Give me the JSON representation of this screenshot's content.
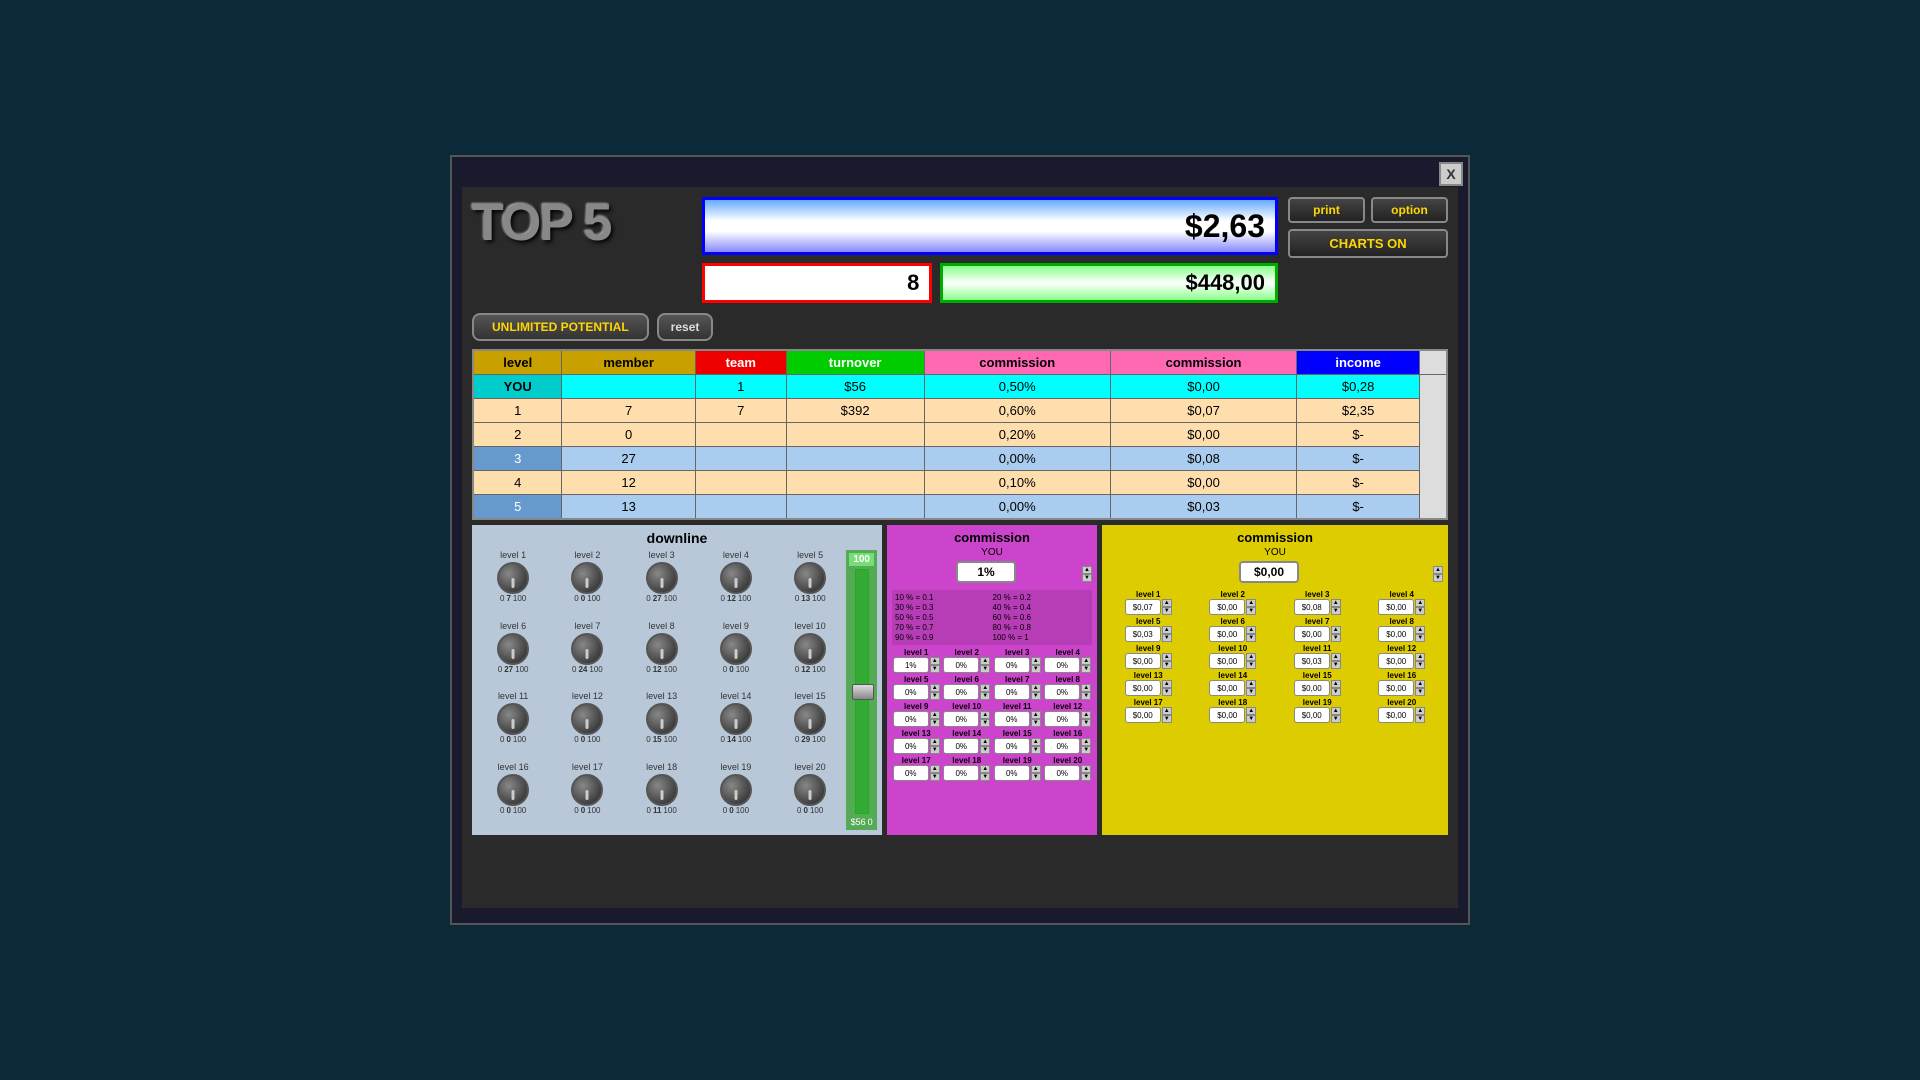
{
  "window": {
    "close_label": "X"
  },
  "header": {
    "logo": "TOP 5",
    "main_value": "$2,63",
    "red_value": "8",
    "green_value": "$448,00",
    "print_label": "print",
    "option_label": "option",
    "charts_label": "CHARTS ON",
    "unlimited_label": "UNLIMITED POTENTIAL",
    "reset_label": "reset"
  },
  "table": {
    "headers": [
      "level",
      "member",
      "team",
      "turnover",
      "commission",
      "commission",
      "income"
    ],
    "rows": [
      {
        "level": "YOU",
        "member": "",
        "team": "1",
        "turnover": "$56",
        "comm1": "0,50%",
        "comm2": "$0,00",
        "income": "$0,28"
      },
      {
        "level": "1",
        "member": "7",
        "team": "7",
        "turnover": "$392",
        "comm1": "0,60%",
        "comm2": "$0,07",
        "income": "$2,35"
      },
      {
        "level": "2",
        "member": "0",
        "team": "",
        "turnover": "",
        "comm1": "0,20%",
        "comm2": "$0,00",
        "income": "$-"
      },
      {
        "level": "3",
        "member": "27",
        "team": "",
        "turnover": "",
        "comm1": "0,00%",
        "comm2": "$0,08",
        "income": "$-"
      },
      {
        "level": "4",
        "member": "12",
        "team": "",
        "turnover": "",
        "comm1": "0,10%",
        "comm2": "$0,00",
        "income": "$-"
      },
      {
        "level": "5",
        "member": "13",
        "team": "",
        "turnover": "",
        "comm1": "0,00%",
        "comm2": "$0,03",
        "income": "$-"
      }
    ]
  },
  "downline": {
    "title": "downline",
    "slider_top": "100",
    "slider_bottom_left": "$56",
    "slider_bottom_right": "0",
    "levels": [
      {
        "label": "level 1",
        "min": "0",
        "val": "7",
        "max": "100"
      },
      {
        "label": "level 2",
        "min": "0",
        "val": "0",
        "max": "100"
      },
      {
        "label": "level 3",
        "min": "0",
        "val": "27",
        "max": "100"
      },
      {
        "label": "level 4",
        "min": "0",
        "val": "12",
        "max": "100"
      },
      {
        "label": "level 5",
        "min": "0",
        "val": "13",
        "max": "100"
      },
      {
        "label": "level 6",
        "min": "0",
        "val": "27",
        "max": "100"
      },
      {
        "label": "level 7",
        "min": "0",
        "val": "24",
        "max": "100"
      },
      {
        "label": "level 8",
        "min": "0",
        "val": "12",
        "max": "100"
      },
      {
        "label": "level 9",
        "min": "0",
        "val": "0",
        "max": "100"
      },
      {
        "label": "level 10",
        "min": "0",
        "val": "12",
        "max": "100"
      },
      {
        "label": "level 11",
        "min": "0",
        "val": "0",
        "max": "100"
      },
      {
        "label": "level 12",
        "min": "0",
        "val": "0",
        "max": "100"
      },
      {
        "label": "level 13",
        "min": "0",
        "val": "15",
        "max": "100"
      },
      {
        "label": "level 14",
        "min": "0",
        "val": "14",
        "max": "100"
      },
      {
        "label": "level 15",
        "min": "0",
        "val": "29",
        "max": "100"
      },
      {
        "label": "level 16",
        "min": "0",
        "val": "0",
        "max": "100"
      },
      {
        "label": "level 17",
        "min": "0",
        "val": "0",
        "max": "100"
      },
      {
        "label": "level 18",
        "min": "0",
        "val": "11",
        "max": "100"
      },
      {
        "label": "level 19",
        "min": "0",
        "val": "0",
        "max": "100"
      },
      {
        "label": "level 20",
        "min": "0",
        "val": "0",
        "max": "100"
      }
    ]
  },
  "commission_purple": {
    "title": "commission",
    "you_label": "YOU",
    "you_value": "1%",
    "legend": [
      "10 % = 0.1",
      "20 % = 0.2",
      "30 % = 0.3",
      "40 % = 0.4",
      "50 % = 0.5",
      "60 % = 0.6",
      "70 % = 0.7",
      "80 % = 0.8",
      "90 % = 0.9",
      "100 % = 1"
    ],
    "levels": [
      {
        "label": "level 1",
        "value": "1%"
      },
      {
        "label": "level 2",
        "value": "0%"
      },
      {
        "label": "level 3",
        "value": "0%"
      },
      {
        "label": "level 4",
        "value": "0%"
      },
      {
        "label": "level 5",
        "value": "0%"
      },
      {
        "label": "level 6",
        "value": "0%"
      },
      {
        "label": "level 7",
        "value": "0%"
      },
      {
        "label": "level 8",
        "value": "0%"
      },
      {
        "label": "level 9",
        "value": "0%"
      },
      {
        "label": "level 10",
        "value": "0%"
      },
      {
        "label": "level 11",
        "value": "0%"
      },
      {
        "label": "level 12",
        "value": "0%"
      },
      {
        "label": "level 13",
        "value": "0%"
      },
      {
        "label": "level 14",
        "value": "0%"
      },
      {
        "label": "level 15",
        "value": "0%"
      },
      {
        "label": "level 16",
        "value": "0%"
      },
      {
        "label": "level 17",
        "value": "0%"
      },
      {
        "label": "level 18",
        "value": "0%"
      },
      {
        "label": "level 19",
        "value": "0%"
      },
      {
        "label": "level 20",
        "value": "0%"
      }
    ]
  },
  "commission_yellow": {
    "title": "commission",
    "you_label": "YOU",
    "you_value": "$0,00",
    "levels": [
      {
        "label": "level 1",
        "value": "$0,07"
      },
      {
        "label": "level 2",
        "value": "$0,00"
      },
      {
        "label": "level 3",
        "value": "$0,08"
      },
      {
        "label": "level 4",
        "value": "$0,00"
      },
      {
        "label": "level 5",
        "value": "$0,03"
      },
      {
        "label": "level 6",
        "value": "$0,00"
      },
      {
        "label": "level 7",
        "value": "$0,00"
      },
      {
        "label": "level 8",
        "value": "$0,00"
      },
      {
        "label": "level 9",
        "value": "$0,00"
      },
      {
        "label": "level 10",
        "value": "$0,00"
      },
      {
        "label": "level 11",
        "value": "$0,03"
      },
      {
        "label": "level 12",
        "value": "$0,00"
      },
      {
        "label": "level 13",
        "value": "$0,00"
      },
      {
        "label": "level 14",
        "value": "$0,00"
      },
      {
        "label": "level 15",
        "value": "$0,00"
      },
      {
        "label": "level 16",
        "value": "$0,00"
      },
      {
        "label": "level 17",
        "value": "$0,00"
      },
      {
        "label": "level 18",
        "value": "$0,00"
      },
      {
        "label": "level 19",
        "value": "$0,00"
      },
      {
        "label": "level 20",
        "value": "$0,00"
      }
    ]
  }
}
